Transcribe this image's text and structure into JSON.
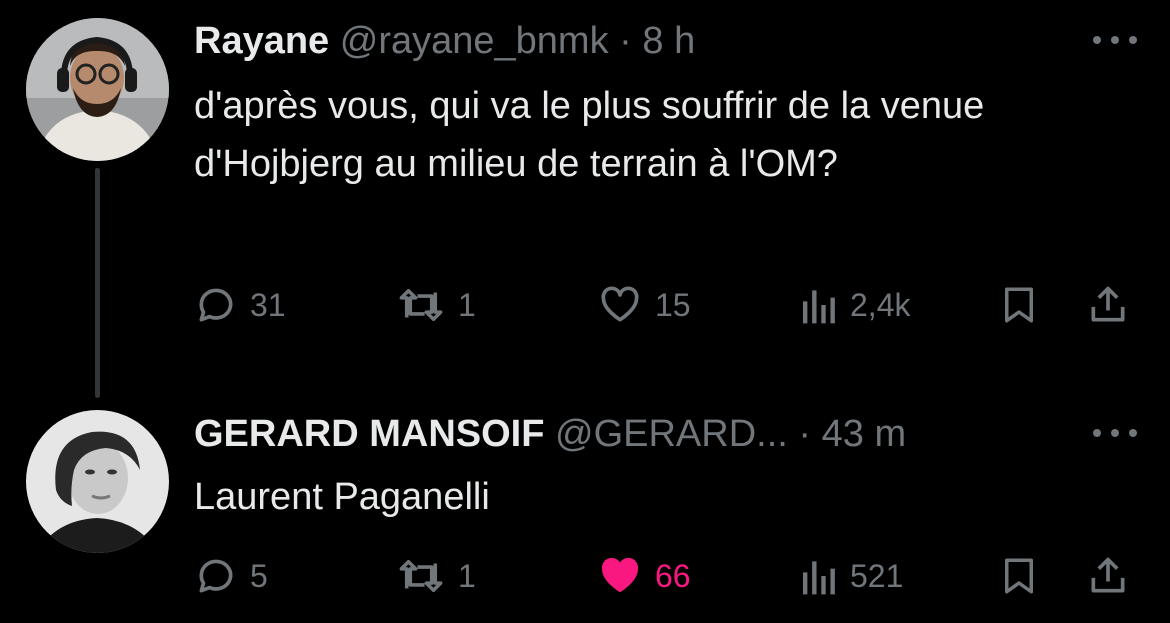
{
  "tweets": [
    {
      "author_name": "Rayane",
      "handle": "@rayane_bnmk",
      "separator": "·",
      "time": "8 h",
      "text": "d'après vous, qui va le plus souffrir de la venue d'Hojbjerg au milieu de terrain à l'OM?",
      "replies": "31",
      "retweets": "1",
      "likes": "15",
      "views": "2,4k",
      "liked": false
    },
    {
      "author_name": "GERARD MANSOIF",
      "handle": "@GERARD...",
      "separator": "·",
      "time": "43 m",
      "text": "Laurent Paganelli",
      "replies": "5",
      "retweets": "1",
      "likes": "66",
      "views": "521",
      "liked": true
    }
  ],
  "colors": {
    "background": "#000000",
    "text_primary": "#e7e9ea",
    "text_secondary": "#71767b",
    "like_active": "#f91880",
    "thread_line": "#333639"
  },
  "icons": [
    "reply-icon",
    "retweet-icon",
    "heart-icon",
    "views-icon",
    "bookmark-icon",
    "share-icon",
    "more-icon"
  ]
}
